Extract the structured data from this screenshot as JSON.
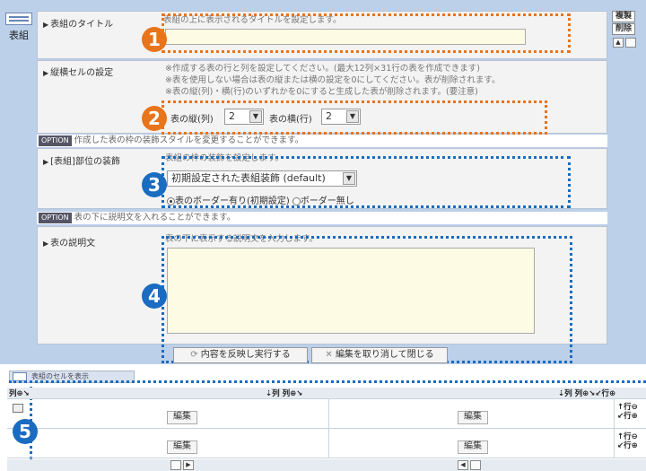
{
  "sidebar": {
    "label": "表組"
  },
  "side_buttons": {
    "copy": "複製",
    "delete": "削除"
  },
  "sections": {
    "title": {
      "label": "表組のタイトル",
      "note": "表組の上に表示されるタイトルを設定します。"
    },
    "cells": {
      "label": "縦横セルの設定",
      "notes": [
        "※作成する表の行と列を設定してください。(最大12列×31行の表を作成できます)",
        "※表を使用しない場合は表の縦または横の設定を0にしてください。表が削除されます。",
        "※表の縦(列)・横(行)のいずれかを0にすると生成した表が削除されます。(要注意)"
      ],
      "cols_label": "表の縦(列)",
      "cols_value": "2",
      "rows_label": "表の横(行)",
      "rows_value": "2"
    },
    "option1": {
      "tag": "OPTION",
      "text": "作成した表の枠の装飾スタイルを変更することができます。"
    },
    "decoration": {
      "label": "[表組]部位の装飾",
      "note": "表組の枠の装飾を設定します。",
      "select_value": "初期設定された表組装飾 (default)",
      "radio_on": "表のボーダー有り(初期設定)",
      "radio_off": "ボーダー無し"
    },
    "option2": {
      "tag": "OPTION",
      "text": "表の下に説明文を入れることができます。"
    },
    "description": {
      "label": "表の説明文",
      "note": "表の下に表示する説明文を入力します。"
    }
  },
  "buttons": {
    "apply": "内容を反映し実行する",
    "cancel": "編集を取り消して閉じる"
  },
  "markers": [
    "1",
    "2",
    "3",
    "4",
    "5"
  ],
  "grid": {
    "tab_label": "表組のセルを表示",
    "col_ctrl_left": "列",
    "col_ctrl_mid": "列 列",
    "row_ctrl": "行",
    "edit_label": "編集",
    "cells": [
      [
        "編集",
        "編集"
      ],
      [
        "編集",
        "編集"
      ]
    ]
  },
  "colors": {
    "orange": "#e8741b",
    "blue": "#1a6cc0",
    "panel": "#bcd0ea"
  }
}
